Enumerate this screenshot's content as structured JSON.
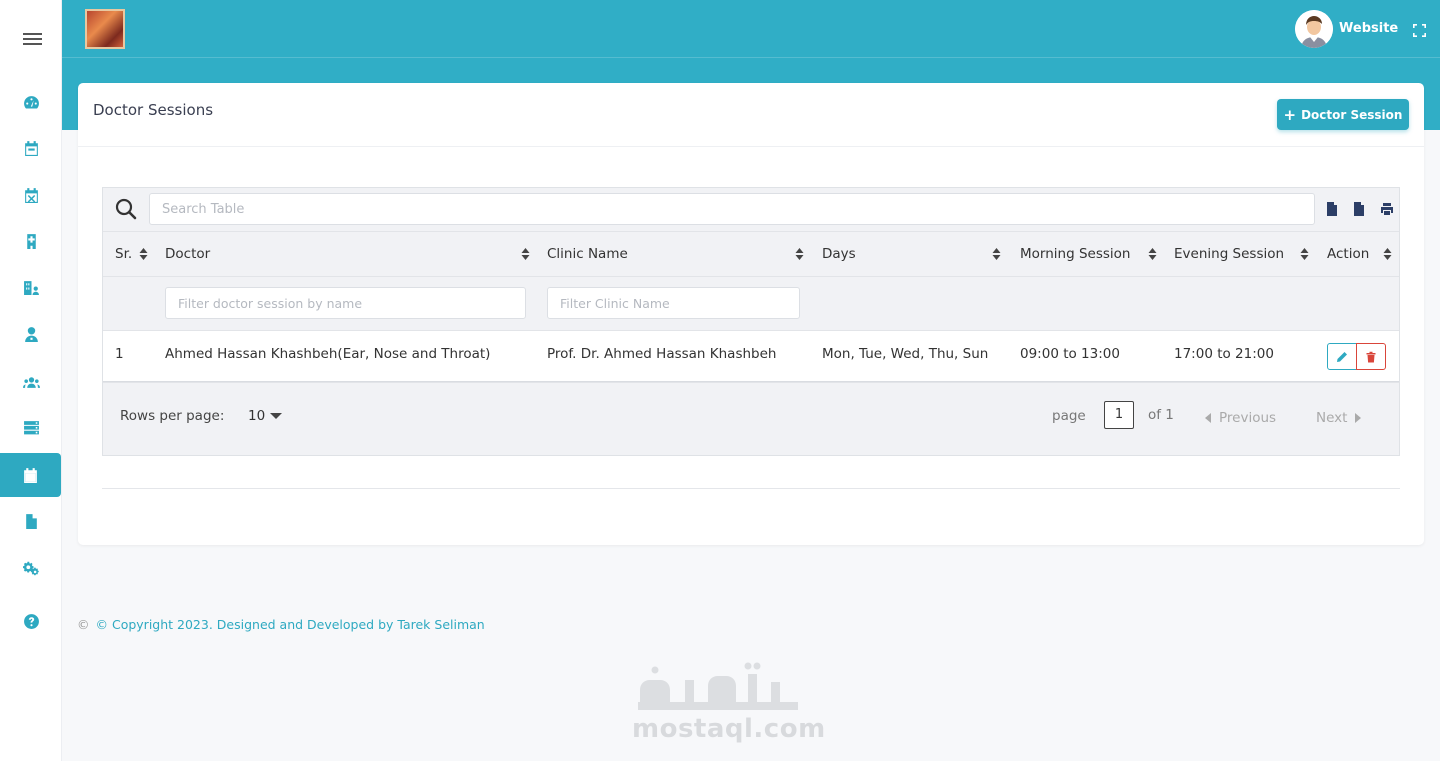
{
  "header": {
    "website_label": "Website"
  },
  "sidebar": {
    "items": [
      {
        "icon": "dashboard-icon"
      },
      {
        "icon": "calendar-icon"
      },
      {
        "icon": "calendar-x-icon"
      },
      {
        "icon": "hospital-icon"
      },
      {
        "icon": "clinic-user-icon"
      },
      {
        "icon": "doctor-icon"
      },
      {
        "icon": "users-icon"
      },
      {
        "icon": "server-icon"
      },
      {
        "icon": "calendar-icon",
        "active": true
      },
      {
        "icon": "file-icon"
      },
      {
        "icon": "cogs-icon"
      },
      {
        "icon": "help-icon"
      }
    ]
  },
  "page": {
    "title": "Doctor Sessions",
    "add_button_label": "Doctor Session"
  },
  "table": {
    "search_placeholder": "Search Table",
    "columns": [
      "Sr.",
      "Doctor",
      "Clinic Name",
      "Days",
      "Morning Session",
      "Evening Session",
      "Action"
    ],
    "filters": {
      "doctor_placeholder": "Filter doctor session by name",
      "clinic_placeholder": "Filter Clinic Name"
    },
    "rows": [
      {
        "sr": "1",
        "doctor": "Ahmed Hassan Khashbeh(Ear, Nose and Throat)",
        "clinic": "Prof. Dr. Ahmed Hassan Khashbeh",
        "days": "Mon, Tue, Wed, Thu, Sun",
        "morning": "09:00 to 13:00",
        "evening": "17:00 to 21:00"
      }
    ],
    "pagination": {
      "rows_label": "Rows per page:",
      "rows_value": "10",
      "page_label": "page",
      "page_value": "1",
      "of_label": "of 1",
      "prev_label": "Previous",
      "next_label": "Next"
    }
  },
  "footer": {
    "symbol": "©",
    "text": "© Copyright 2023. Designed and Developed by Tarek Seliman"
  },
  "watermark": {
    "text": "mostaql.com"
  },
  "colors": {
    "accent": "#30aec6",
    "delete": "#d9453a"
  }
}
